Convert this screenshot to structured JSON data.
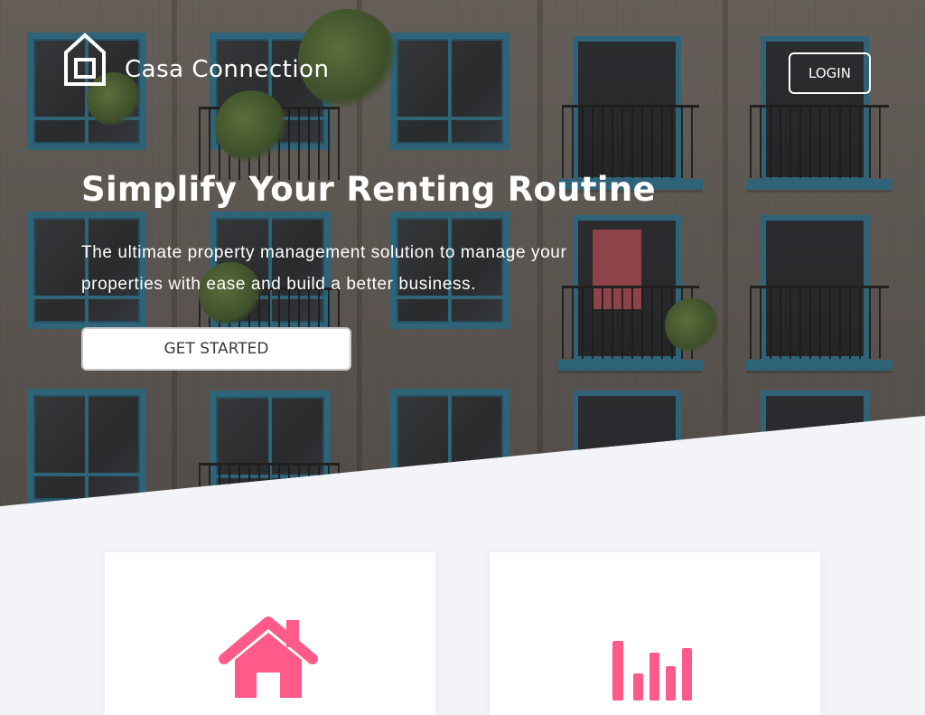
{
  "brand": {
    "name": "Casa Connection",
    "logo_icon": "house-outline-icon"
  },
  "nav": {
    "login_label": "LOGIN"
  },
  "hero": {
    "headline": "Simplify Your Renting Routine",
    "subheadline": "The ultimate property management solution to manage your properties with ease and build a better business.",
    "cta_label": "GET STARTED",
    "background": "apartment-building-balconies-photo"
  },
  "features": [
    {
      "icon": "home-icon",
      "icon_color": "#ff5a8a"
    },
    {
      "icon": "bar-chart-icon",
      "icon_color": "#ff5a8a"
    }
  ],
  "colors": {
    "accent": "#ff5a8a",
    "page_background": "#f3f4f8",
    "window_frame": "#2f8eb3"
  }
}
